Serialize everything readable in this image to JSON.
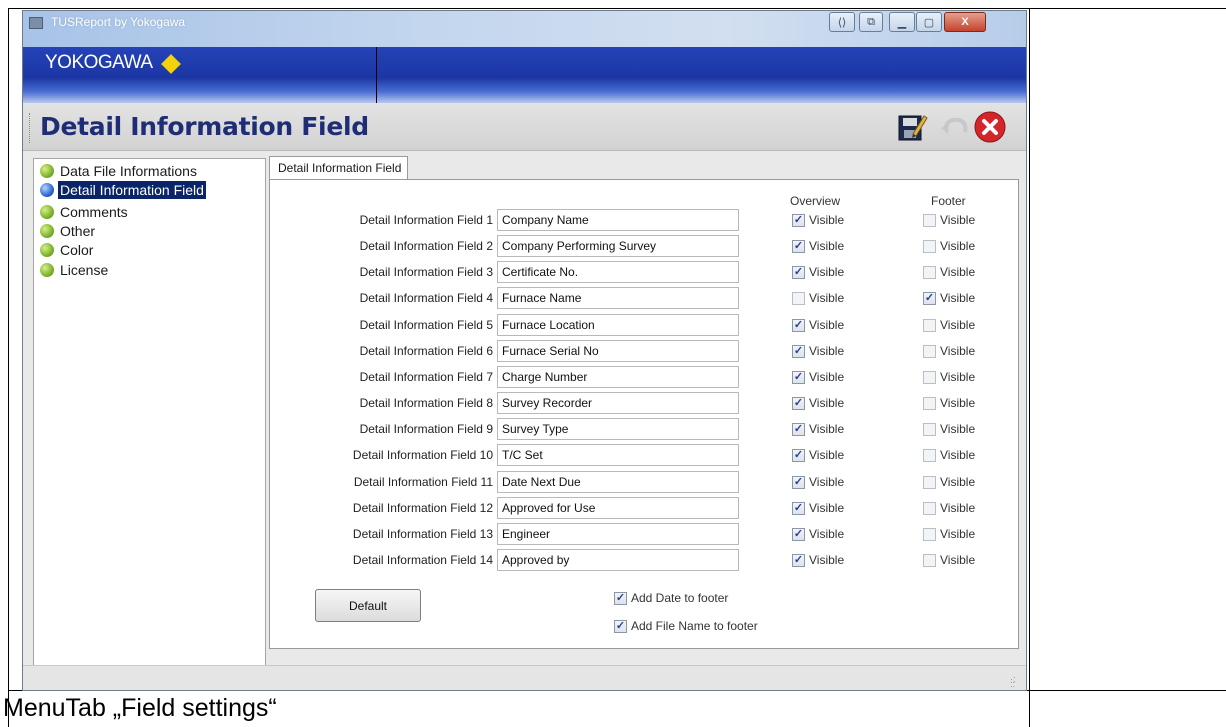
{
  "window": {
    "title": "TUSReport by Yokogawa",
    "brand": "YOKOGAWA",
    "controls": {
      "resize_label": "⟨⟩",
      "restore_label": "⧉",
      "minimize_label": "▁",
      "maximize_label": "▢",
      "close_label": "X"
    }
  },
  "header": {
    "title": "Detail Information Field",
    "icons": [
      "save-edit-icon",
      "undo-icon",
      "close-icon"
    ]
  },
  "sidebar": {
    "items": [
      {
        "label": "Data File Informations",
        "status_color": "#7db32a"
      },
      {
        "label": "Detail Information Field",
        "status_color": "#2d68cf",
        "selected": true
      },
      {
        "label": "Comments",
        "status_color": "#7db32a"
      },
      {
        "label": "Other",
        "status_color": "#7db32a"
      },
      {
        "label": "Color",
        "status_color": "#7db32a"
      },
      {
        "label": "License",
        "status_color": "#7db32a"
      }
    ]
  },
  "tab": {
    "label": "Detail Information Field"
  },
  "columns": {
    "overview": "Overview",
    "footer": "Footer"
  },
  "fields": [
    {
      "label": "Detail Information Field 1",
      "value": "Company Name",
      "overview_label": "Visible",
      "overview": true,
      "footer_label": "Visible",
      "footer": false
    },
    {
      "label": "Detail Information Field 2",
      "value": "Company Performing Survey",
      "overview_label": "Visible",
      "overview": true,
      "footer_label": "Visible",
      "footer": false
    },
    {
      "label": "Detail Information Field 3",
      "value": "Certificate No.",
      "overview_label": "Visible",
      "overview": true,
      "footer_label": "Visible",
      "footer": false
    },
    {
      "label": "Detail Information Field 4",
      "value": "Furnace Name",
      "overview_label": "Visible",
      "overview": false,
      "footer_label": "Visible",
      "footer": true
    },
    {
      "label": "Detail Information Field 5",
      "value": "Furnace Location",
      "overview_label": "Visible",
      "overview": true,
      "footer_label": "Visible",
      "footer": false
    },
    {
      "label": "Detail Information Field 6",
      "value": "Furnace Serial No",
      "overview_label": "Visible",
      "overview": true,
      "footer_label": "Visible",
      "footer": false
    },
    {
      "label": "Detail Information Field 7",
      "value": "Charge Number",
      "overview_label": "Visible",
      "overview": true,
      "footer_label": "Visible",
      "footer": false
    },
    {
      "label": "Detail Information Field 8",
      "value": "Survey Recorder",
      "overview_label": "Visible",
      "overview": true,
      "footer_label": "Visible",
      "footer": false
    },
    {
      "label": "Detail Information Field 9",
      "value": "Survey Type",
      "overview_label": "Visible",
      "overview": true,
      "footer_label": "Visible",
      "footer": false
    },
    {
      "label": "Detail Information Field 10",
      "value": "T/C Set",
      "overview_label": "Visible",
      "overview": true,
      "footer_label": "Visible",
      "footer": false
    },
    {
      "label": "Detail Information Field 11",
      "value": "Date Next Due",
      "overview_label": "Visible",
      "overview": true,
      "footer_label": "Visible",
      "footer": false
    },
    {
      "label": "Detail Information Field 12",
      "value": "Approved for Use",
      "overview_label": "Visible",
      "overview": true,
      "footer_label": "Visible",
      "footer": false
    },
    {
      "label": "Detail Information Field 13",
      "value": "Engineer",
      "overview_label": "Visible",
      "overview": true,
      "footer_label": "Visible",
      "footer": false
    },
    {
      "label": "Detail Information Field 14",
      "value": "Approved by",
      "overview_label": "Visible",
      "overview": true,
      "footer_label": "Visible",
      "footer": false
    }
  ],
  "options": {
    "default_button": "Default",
    "add_date": {
      "label": "Add Date to footer",
      "checked": true
    },
    "add_file_name": {
      "label": "Add File Name to footer",
      "checked": true
    }
  },
  "caption": "MenuTab  „Field settings“"
}
